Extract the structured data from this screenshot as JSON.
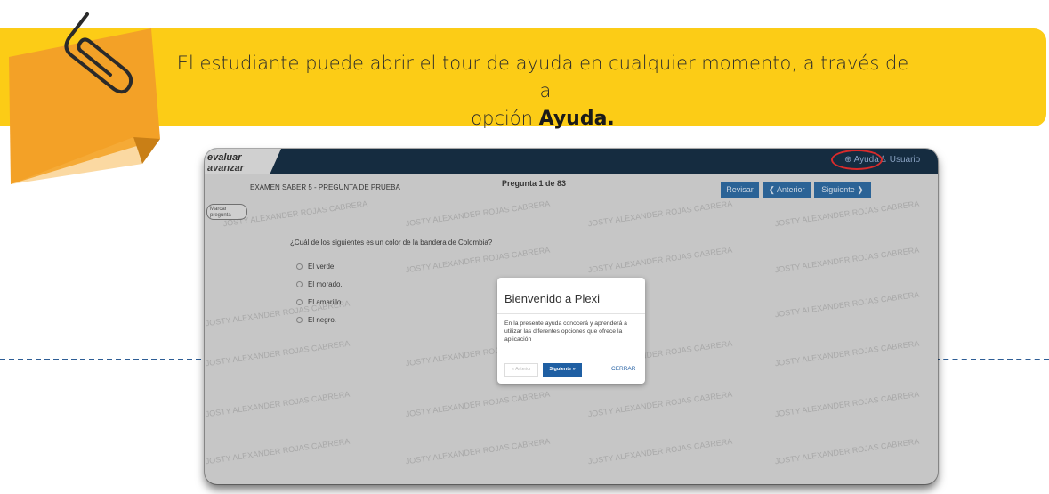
{
  "banner": {
    "line1": "El estudiante puede abrir el tour de ayuda en cualquier momento, a través de la",
    "line2_prefix": "opción ",
    "line2_bold": "Ayuda."
  },
  "app": {
    "logo_line1": "evaluar",
    "logo_line2": "avanzar",
    "help_label": "Ayuda",
    "user_label": "Usuario",
    "exam_title": "EXAMEN SABER 5 - PREGUNTA DE PRUEBA",
    "question_counter": "Pregunta 1 de 83",
    "review_label": "Revisar",
    "prev_label": "Anterior",
    "next_label": "Siguiente",
    "mark_label_1": "Marcar",
    "mark_label_2": "pregunta",
    "question": "¿Cuál de los siguientes es un color de la bandera de Colombia?",
    "options": [
      "El verde.",
      "El morado.",
      "El amarillo.",
      "El negro."
    ],
    "watermark": "JOSTY ALEXANDER ROJAS CABRERA"
  },
  "modal": {
    "title": "Bienvenido a Plexi",
    "body": "En la presente ayuda conocerá y aprenderá a utilizar las diferentes opciones que ofrece la aplicación",
    "prev_label": "« Anterior",
    "next_label": "Siguiente »",
    "close_label": "CERRAR"
  },
  "colors": {
    "banner": "#fccc16",
    "note": "#f5a623",
    "header": "#152c40",
    "button": "#2e6aa0",
    "highlight_circle": "#d92b2b",
    "dash": "#2d5d95"
  }
}
